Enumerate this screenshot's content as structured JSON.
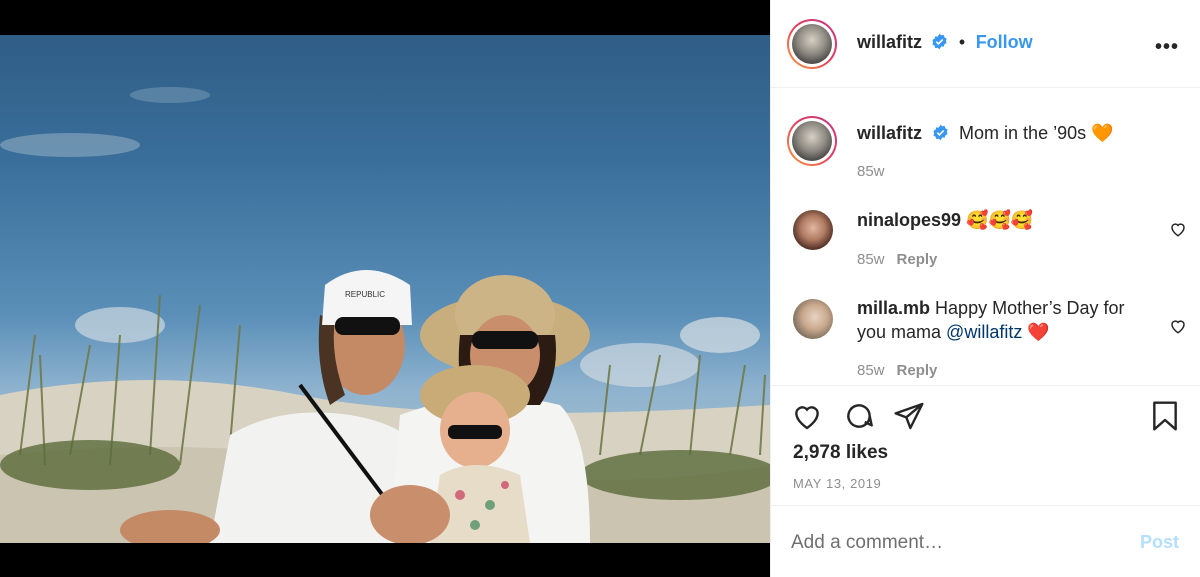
{
  "post": {
    "username": "willafitz",
    "follow_label": "Follow",
    "dot": "•",
    "more_label": "•••",
    "caption": {
      "username": "willafitz",
      "text": "Mom in the ’90s",
      "emoji": "🧡",
      "age": "85w"
    },
    "comments": [
      {
        "username": "ninalopes99",
        "text": "🥰🥰🥰",
        "age": "85w",
        "reply_label": "Reply"
      },
      {
        "username": "milla.mb",
        "text_before": "Happy Mother’s Day for you mama ",
        "mention": "@willafitz",
        "emoji": "❤️",
        "age": "85w",
        "reply_label": "Reply"
      }
    ],
    "likes": "2,978 likes",
    "date": "MAY 13, 2019",
    "add_comment_placeholder": "Add a comment…",
    "post_label": "Post",
    "photo_cap_text": "REPUBLIC"
  },
  "colors": {
    "link_blue": "#3897f0",
    "post_disabled": "#b2dffc",
    "muted": "#8e8e8e",
    "text": "#262626"
  }
}
